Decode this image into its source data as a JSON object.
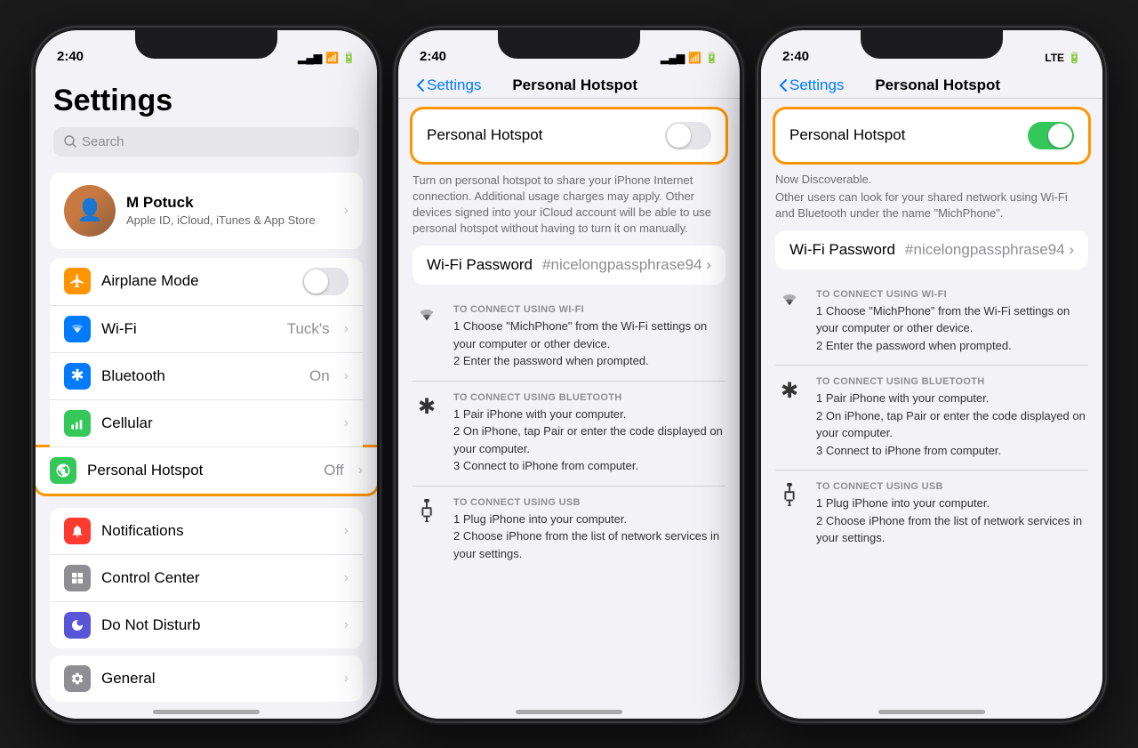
{
  "phone1": {
    "status_time": "2:40",
    "title": "Settings",
    "search_placeholder": "Search",
    "profile": {
      "name": "M Potuck",
      "subtitle": "Apple ID, iCloud, iTunes & App Store"
    },
    "group1": [
      {
        "icon": "✈",
        "icon_color": "icon-orange",
        "label": "Airplane Mode",
        "value": "",
        "has_toggle": true,
        "toggle_on": false
      },
      {
        "icon": "📶",
        "icon_color": "icon-blue",
        "label": "Wi-Fi",
        "value": "Tuck's",
        "has_toggle": false
      },
      {
        "icon": "🔵",
        "icon_color": "icon-blue2",
        "label": "Bluetooth",
        "value": "On",
        "has_toggle": false
      },
      {
        "icon": "📡",
        "icon_color": "icon-green",
        "label": "Cellular",
        "value": "",
        "has_toggle": false
      },
      {
        "icon": "🔗",
        "icon_color": "icon-green2",
        "label": "Personal Hotspot",
        "value": "Off",
        "has_toggle": false,
        "highlighted": true
      }
    ],
    "group2": [
      {
        "icon": "🔔",
        "icon_color": "icon-red",
        "label": "Notifications",
        "value": ""
      },
      {
        "icon": "⚙",
        "icon_color": "icon-gray",
        "label": "Control Center",
        "value": ""
      },
      {
        "icon": "🌙",
        "icon_color": "icon-purple",
        "label": "Do Not Disturb",
        "value": ""
      }
    ],
    "group3": [
      {
        "icon": "⚙",
        "icon_color": "icon-gray",
        "label": "General",
        "value": ""
      }
    ]
  },
  "phone2": {
    "status_time": "2:40",
    "nav_back": "Settings",
    "nav_title": "Personal Hotspot",
    "hotspot_label": "Personal Hotspot",
    "hotspot_on": false,
    "description": "Turn on personal hotspot to share your iPhone Internet connection. Additional usage charges may apply. Other devices signed into your iCloud account will be able to use personal hotspot without having to turn it on manually.",
    "wifi_password_label": "Wi-Fi Password",
    "wifi_password_value": "#nicelongpassphrase94",
    "connect_sections": [
      {
        "icon": "wifi",
        "title": "TO CONNECT USING WI-FI",
        "steps": "1 Choose \"MichPhone\" from the Wi-Fi settings on your computer or other device.\n2 Enter the password when prompted."
      },
      {
        "icon": "bluetooth",
        "title": "TO CONNECT USING BLUETOOTH",
        "steps": "1 Pair iPhone with your computer.\n2 On iPhone, tap Pair or enter the code displayed on your computer.\n3 Connect to iPhone from computer."
      },
      {
        "icon": "usb",
        "title": "TO CONNECT USING USB",
        "steps": "1 Plug iPhone into your computer.\n2 Choose iPhone from the list of network services in your settings."
      }
    ]
  },
  "phone3": {
    "status_time": "2:40",
    "status_network": "LTE",
    "nav_back": "Settings",
    "nav_title": "Personal Hotspot",
    "hotspot_label": "Personal Hotspot",
    "hotspot_on": true,
    "now_discoverable": "Now Discoverable.",
    "discoverable_desc": "Other users can look for your shared network using Wi-Fi and Bluetooth under the name \"MichPhone\".",
    "wifi_password_label": "Wi-Fi Password",
    "wifi_password_value": "#nicelongpassphrase94",
    "connect_sections": [
      {
        "icon": "wifi",
        "title": "TO CONNECT USING WI-FI",
        "steps": "1 Choose \"MichPhone\" from the Wi-Fi settings on your computer or other device.\n2 Enter the password when prompted."
      },
      {
        "icon": "bluetooth",
        "title": "TO CONNECT USING BLUETOOTH",
        "steps": "1 Pair iPhone with your computer.\n2 On iPhone, tap Pair or enter the code displayed on your computer.\n3 Connect to iPhone from computer."
      },
      {
        "icon": "usb",
        "title": "TO CONNECT USING USB",
        "steps": "1 Plug iPhone into your computer.\n2 Choose iPhone from the list of network services in your settings."
      }
    ]
  }
}
